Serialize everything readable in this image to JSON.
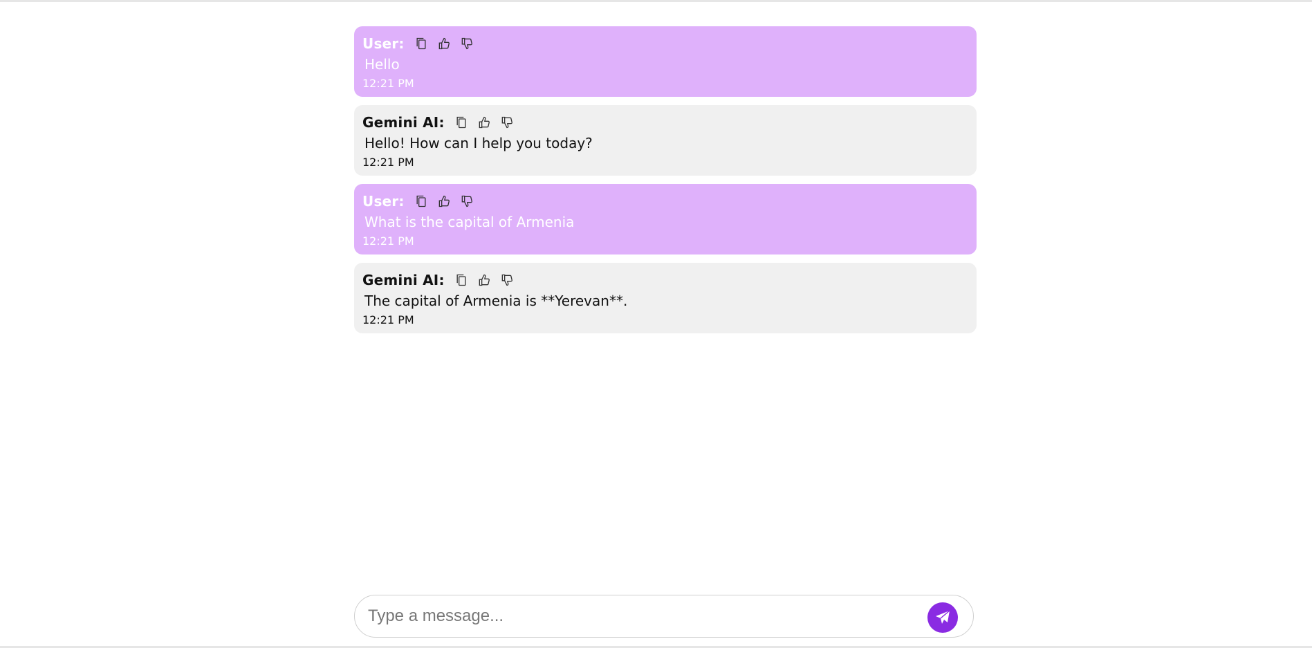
{
  "messages": [
    {
      "role": "user",
      "sender": "User:",
      "text": "Hello",
      "time": "12:21 PM"
    },
    {
      "role": "ai",
      "sender": "Gemini AI:",
      "text": "Hello! How can I help you today?",
      "time": "12:21 PM"
    },
    {
      "role": "user",
      "sender": "User:",
      "text": "What is the capital of Armenia",
      "time": "12:21 PM"
    },
    {
      "role": "ai",
      "sender": "Gemini AI:",
      "text": "The capital of Armenia is **Yerevan**.",
      "time": "12:21 PM"
    }
  ],
  "composer": {
    "placeholder": "Type a message..."
  },
  "colors": {
    "user_bubble": "#dfb1fb",
    "ai_bubble": "#f0f0f0",
    "send_button": "#8a2be2"
  },
  "icons": {
    "copy": "copy-icon",
    "like": "thumbs-up-icon",
    "dislike": "thumbs-down-icon",
    "send": "send-icon"
  }
}
